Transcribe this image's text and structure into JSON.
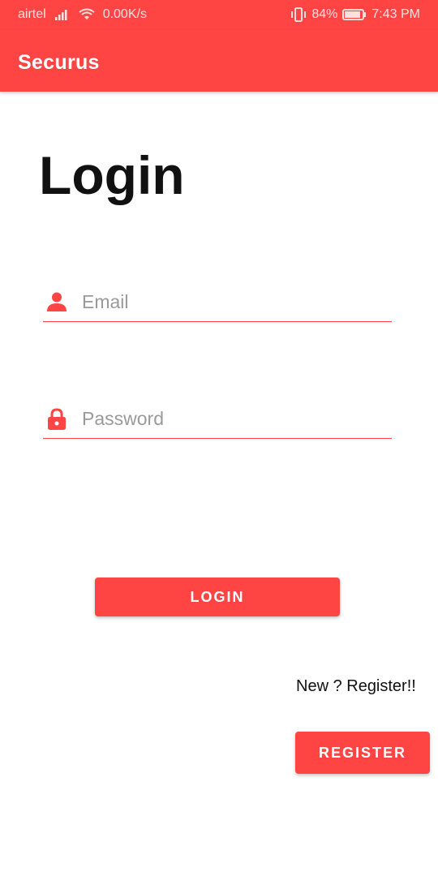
{
  "status_bar": {
    "carrier": "airtel",
    "net_speed": "0.00K/s",
    "battery_percent": "84%",
    "time": "7:43 PM",
    "icons": [
      "signal-icon",
      "wifi-icon",
      "vibrate-icon",
      "battery-icon"
    ]
  },
  "app_bar": {
    "title": "Securus"
  },
  "page": {
    "heading": "Login"
  },
  "form": {
    "email": {
      "placeholder": "Email",
      "value": "",
      "icon": "person-icon"
    },
    "password": {
      "placeholder": "Password",
      "value": "",
      "icon": "lock-icon"
    },
    "login_label": "LOGIN"
  },
  "register": {
    "hint": "New ? Register!!",
    "button_label": "REGISTER"
  },
  "colors": {
    "accent": "#ff4444",
    "text": "#111111",
    "placeholder": "#9a9a9a"
  }
}
